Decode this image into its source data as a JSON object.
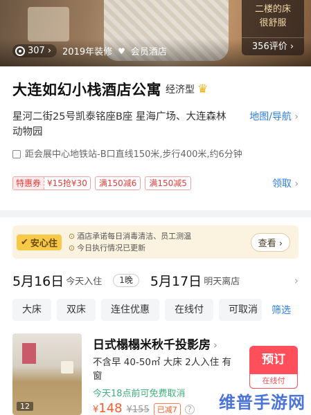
{
  "hero": {
    "review_quote_line1": "二楼的床",
    "review_quote_line2": "很舒服",
    "review_count": "356评价",
    "photo_count": "307",
    "photo_count_arrow": "›",
    "year_label": "2019年装修",
    "member_label": "会员酒店"
  },
  "hotel": {
    "name": "大连如幻小栈酒店公寓",
    "type": "经济型",
    "address": "星河二街25号凯泰铭座B座 星海广场、大连森林动物园",
    "map_link": "地图/导航",
    "metro": "距会展中心地铁站-B口直线150米,步行400米,约6分钟"
  },
  "coupons": {
    "tag": "特惠券",
    "value": "¥15抢¥30",
    "offer1": "满150减6",
    "offer2": "满150减5",
    "receive": "领取"
  },
  "safety": {
    "badge": "安心住",
    "line1": "酒店承诺每日消毒清洁、员工测温",
    "line2": "今日执行情况已更新",
    "view_button": "查看"
  },
  "dates": {
    "checkin_date": "5月16日",
    "checkin_label": "今天入住",
    "nights": "1晚",
    "checkout_date": "5月17日",
    "checkout_label": "明天离店"
  },
  "filters": {
    "items": [
      "大床",
      "双床",
      "连住优惠",
      "在线付",
      "可取消"
    ],
    "filter_button": "筛选"
  },
  "room": {
    "name": "日式榻榻米秋千投影房",
    "desc": "不含早 40-50㎡ 大床 2人入住 有窗",
    "free_cancel": "今天18点前可免费取消",
    "price": "148",
    "currency": "¥",
    "old_price": "¥155",
    "reduced": "已减7",
    "image_count": "12",
    "book_button": "预订",
    "book_sub": "在线付"
  },
  "watermark": "维普手游网",
  "colors": {
    "accent_blue": "#2a7de1",
    "coupon_red": "#e0403c",
    "book_red": "#ff4f5a",
    "safety_yellow": "#f7c948",
    "free_cancel_green": "#3fb17a",
    "price_orange": "#ff5a2a"
  }
}
